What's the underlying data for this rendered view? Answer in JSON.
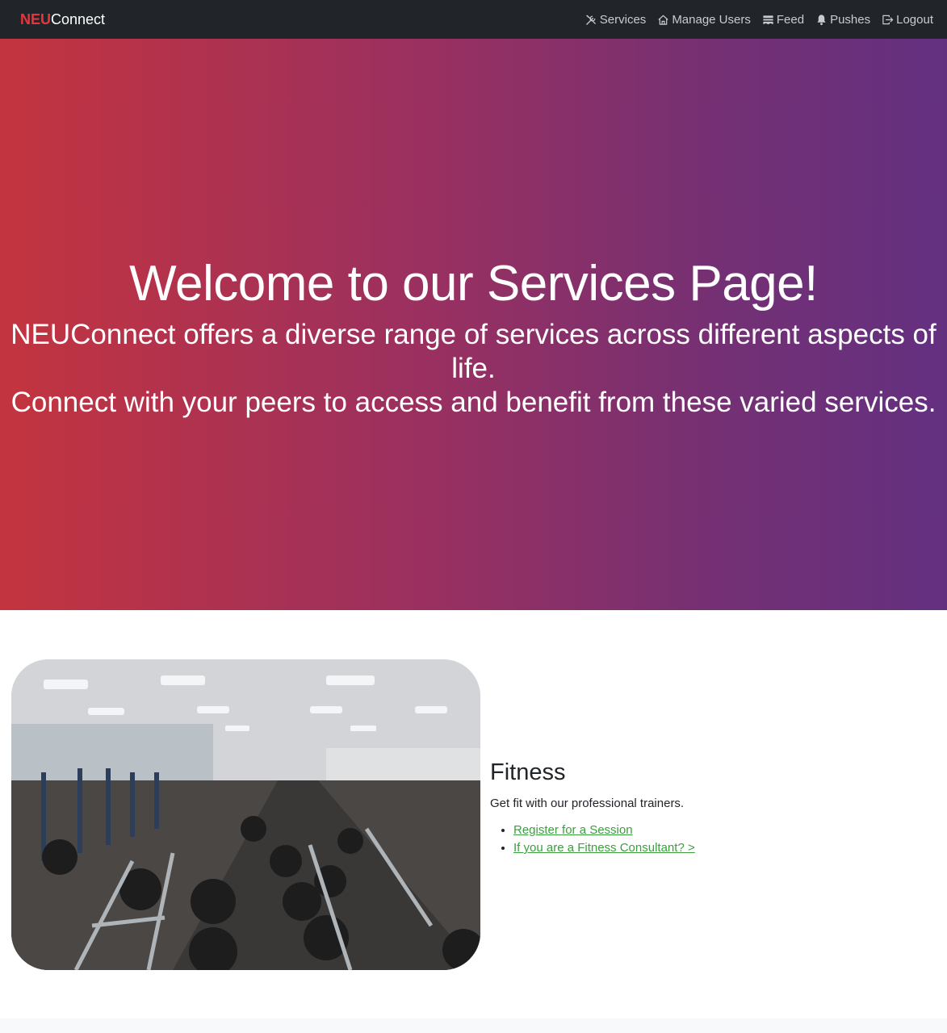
{
  "brand": {
    "part1": "NEU",
    "part2": "Connect"
  },
  "nav": {
    "items": [
      {
        "label": "Services",
        "icon": "tools-icon"
      },
      {
        "label": "Manage Users",
        "icon": "house-icon"
      },
      {
        "label": "Feed",
        "icon": "feed-icon"
      },
      {
        "label": "Pushes",
        "icon": "bell-icon"
      },
      {
        "label": "Logout",
        "icon": "logout-icon"
      }
    ]
  },
  "hero": {
    "title": "Welcome to our Services Page!",
    "line1": "NEUConnect offers a diverse range of services across different aspects of life.",
    "line2": "Connect with your peers to access and benefit from these varied services."
  },
  "service": {
    "title": "Fitness",
    "description": "Get fit with our professional trainers.",
    "links": [
      "Register for a Session",
      "If you are a Fitness Consultant? >"
    ]
  },
  "colors": {
    "navbar": "#212529",
    "brand_accent": "#e8353c",
    "gradient_start": "#c3343f",
    "gradient_end": "#633080",
    "link": "#3b9e3f"
  }
}
